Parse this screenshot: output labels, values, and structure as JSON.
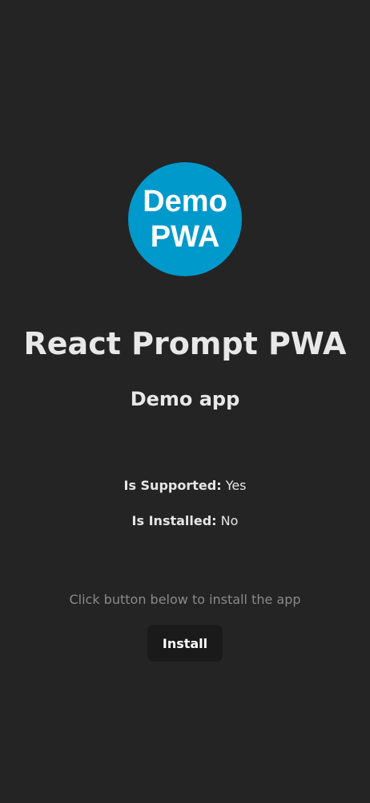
{
  "logo": {
    "line1": "Demo",
    "line2": "PWA",
    "color": "#0099cc"
  },
  "header": {
    "title": "React Prompt PWA",
    "subtitle": "Demo app"
  },
  "status": {
    "supported_label": "Is Supported:",
    "supported_value": "Yes",
    "installed_label": "Is Installed:",
    "installed_value": "No"
  },
  "install": {
    "hint": "Click button below to install the app",
    "button_label": "Install"
  },
  "colors": {
    "background": "#242424",
    "button_background": "#1a1a1a"
  }
}
